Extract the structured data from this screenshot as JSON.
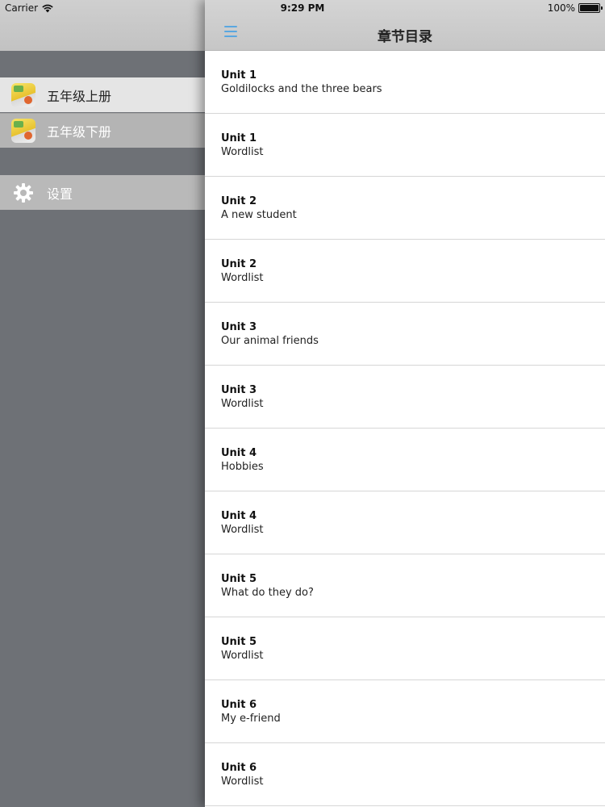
{
  "status_bar": {
    "carrier": "Carrier",
    "time": "9:29 PM",
    "battery": "100%",
    "battery_level": 100
  },
  "sidebar": {
    "books": [
      {
        "label": "五年级上册",
        "icon": "book-cover-icon",
        "active": true
      },
      {
        "label": "五年级下册",
        "icon": "book-cover-icon",
        "active": false
      }
    ],
    "settings_label": "设置"
  },
  "nav": {
    "title": "章节目录",
    "menu_icon": "hamburger-menu-icon",
    "accent": "#5aa7e0"
  },
  "chapters": [
    {
      "unit": "Unit 1",
      "title": "Goldilocks and the three bears"
    },
    {
      "unit": "Unit 1",
      "title": "Wordlist"
    },
    {
      "unit": "Unit 2",
      "title": "A new student"
    },
    {
      "unit": "Unit 2",
      "title": "Wordlist"
    },
    {
      "unit": "Unit 3",
      "title": "Our animal friends"
    },
    {
      "unit": "Unit 3",
      "title": "Wordlist"
    },
    {
      "unit": "Unit 4",
      "title": "Hobbies"
    },
    {
      "unit": "Unit 4",
      "title": "Wordlist"
    },
    {
      "unit": "Unit 5",
      "title": "What do they do?"
    },
    {
      "unit": "Unit 5",
      "title": "Wordlist"
    },
    {
      "unit": "Unit 6",
      "title": "My e-friend"
    },
    {
      "unit": "Unit 6",
      "title": "Wordlist"
    }
  ]
}
